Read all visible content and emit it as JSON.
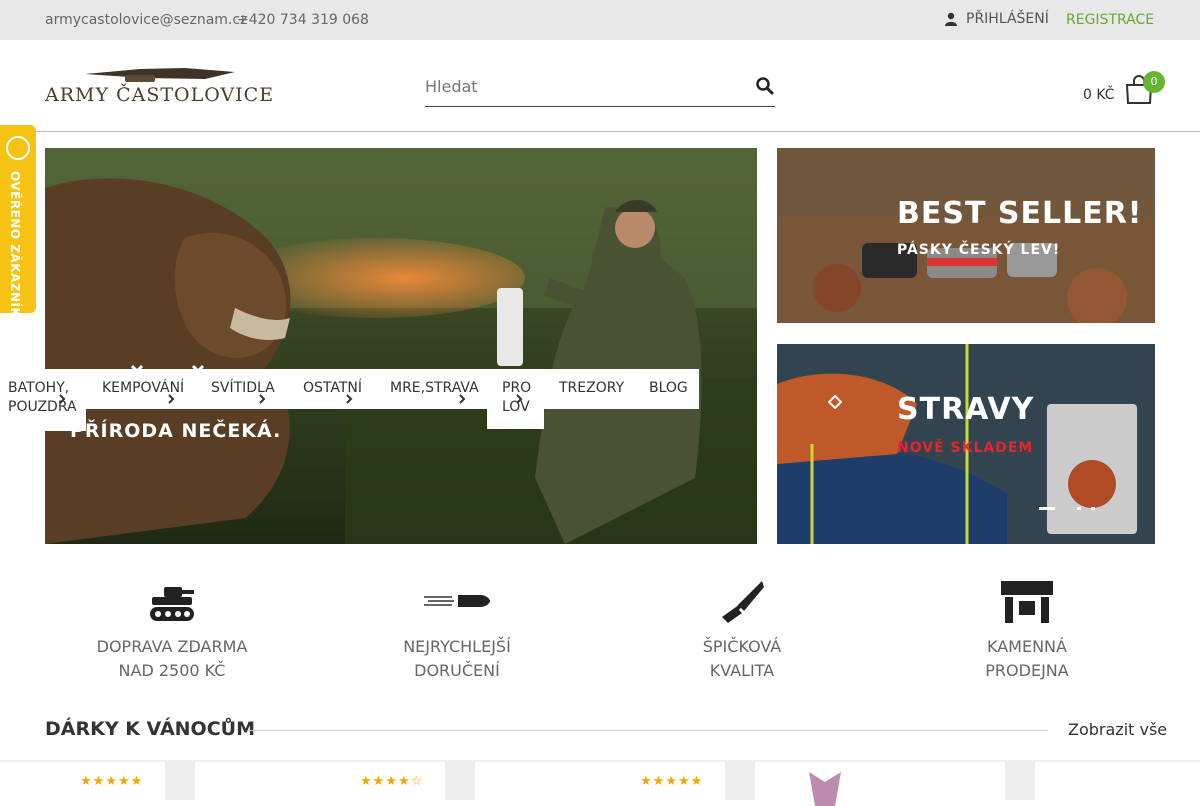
{
  "topbar": {
    "email": "armycastolovice@seznam.cz",
    "phone": "+420 734 319 068",
    "login_label": "PŘIHLÁŠENÍ",
    "register_label": "REGISTRACE"
  },
  "header": {
    "logo_text": "ARMY ČASTOLOVICE",
    "search_placeholder": "Hledat",
    "cart_total": "0 KČ",
    "cart_count": "0"
  },
  "side_badge": {
    "label": "OVĚŘENO ZÁKAZNÍKY"
  },
  "nav": {
    "items": [
      {
        "label_line1": "BATOHY,",
        "label_line2": "POUZDRA"
      },
      {
        "label_line1": "KEMPOVÁNÍ",
        "label_line2": ""
      },
      {
        "label_line1": "SVÍTIDLA",
        "label_line2": ""
      },
      {
        "label_line1": "OSTATNÍ",
        "label_line2": ""
      },
      {
        "label_line1": "MRE,STRAVA",
        "label_line2": ""
      },
      {
        "label_line1": "PRO",
        "label_line2": "LOV"
      },
      {
        "label_line1": "TREZORY",
        "label_line2": ""
      },
      {
        "label_line1": "BLOG",
        "label_line2": ""
      }
    ]
  },
  "hero": {
    "main_caption": "PŘÍRODA NEČEKÁ.",
    "promo1_title": "BEST SELLER!",
    "promo1_subtitle": "PÁSKY ČESKÝ LEV!",
    "promo2_title": "STRAVY",
    "promo2_subtitle": "NOVĚ SKLADEM"
  },
  "features": [
    {
      "line1": "DOPRAVA ZDARMA",
      "line2": "NAD 2500 KČ",
      "icon": "tank-icon"
    },
    {
      "line1": "NEJRYCHLEJŠÍ",
      "line2": "DORUČENÍ",
      "icon": "bullet-icon"
    },
    {
      "line1": "ŠPIČKOVÁ",
      "line2": "KVALITA",
      "icon": "knife-icon"
    },
    {
      "line1": "KAMENNÁ",
      "line2": "PRODEJNA",
      "icon": "store-icon"
    }
  ],
  "section": {
    "title": "DÁRKY K VÁNOCŮM",
    "link": "Zobrazit vše"
  },
  "products": [
    {
      "rating": 5
    },
    {
      "rating": 4.5
    },
    {
      "rating": 5
    },
    {
      "rating": 0
    },
    {
      "rating": 0
    }
  ],
  "colors": {
    "accent_green": "#66a831",
    "badge_yellow": "#f6c315",
    "promo_red": "#e8252a",
    "star": "#f0a800"
  }
}
